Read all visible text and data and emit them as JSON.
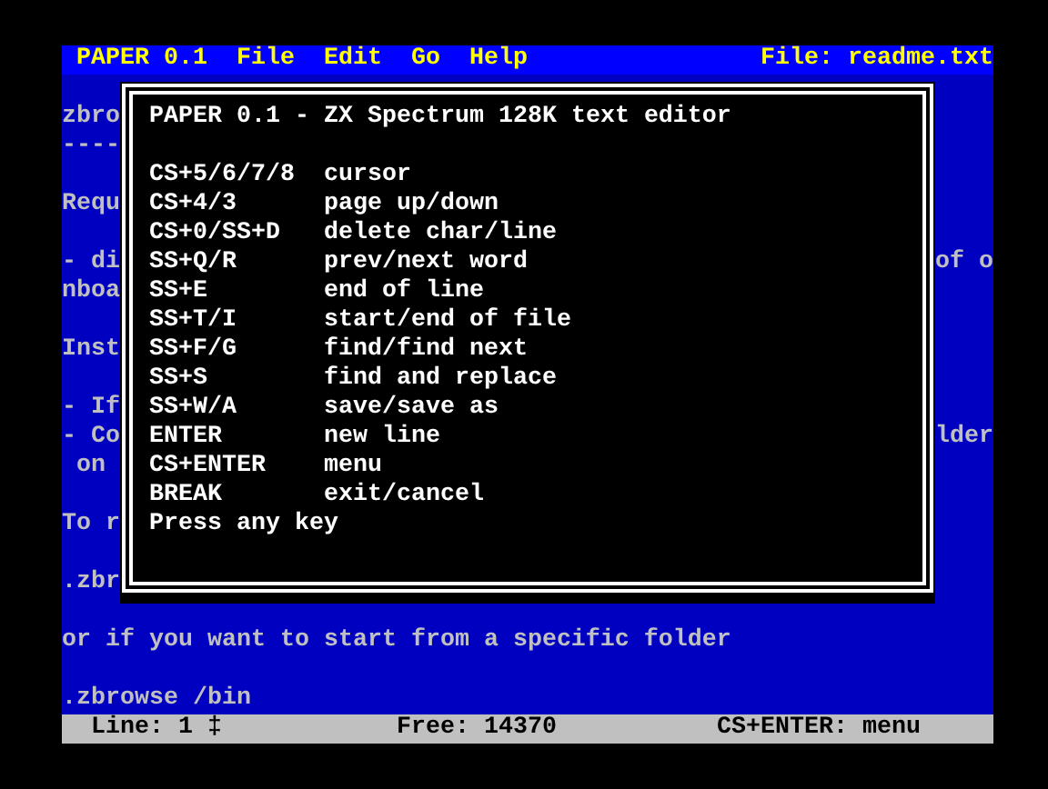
{
  "menu_bar": {
    "title": "PAPER 0.1",
    "items": [
      "File",
      "Edit",
      "Go",
      "Help"
    ],
    "file_label": "File: readme.txt"
  },
  "document_paragraphs": [
    {
      "lines": [
        {
          "left": "zbro"
        },
        {
          "left": "----"
        }
      ]
    },
    {
      "lines": [
        {
          "left": "Requ"
        }
      ]
    },
    {
      "lines": [
        {
          "left": "- di",
          "right": "of o"
        },
        {
          "left": "nboa"
        }
      ]
    },
    {
      "lines": [
        {
          "left": "Inst"
        }
      ]
    },
    {
      "lines": [
        {
          "left": "- If"
        },
        {
          "left": "- Co",
          "right": "lder"
        },
        {
          "left": " on"
        }
      ]
    },
    {
      "lines": [
        {
          "left": "To r"
        }
      ]
    },
    {
      "lines": [
        {
          "left": ".zbr"
        }
      ]
    },
    {
      "lines": [
        {
          "left": "or if you want to start from a specific folder"
        }
      ]
    },
    {
      "lines": [
        {
          "left": ".zbrowse /bin"
        }
      ]
    }
  ],
  "help_dialog": {
    "title": "PAPER 0.1 - ZX Spectrum 128K text editor",
    "shortcuts": [
      {
        "keys": "CS+5/6/7/8",
        "action": "cursor"
      },
      {
        "keys": "CS+4/3",
        "action": "page up/down"
      },
      {
        "keys": "CS+0/SS+D",
        "action": "delete char/line"
      },
      {
        "keys": "SS+Q/R",
        "action": "prev/next word"
      },
      {
        "keys": "SS+E",
        "action": "end of line"
      },
      {
        "keys": "SS+T/I",
        "action": "start/end of file"
      },
      {
        "keys": "SS+F/G",
        "action": "find/find next"
      },
      {
        "keys": "SS+S",
        "action": "find and replace"
      },
      {
        "keys": "SS+W/A",
        "action": "save/save as"
      },
      {
        "keys": "ENTER",
        "action": "new line"
      },
      {
        "keys": "CS+ENTER",
        "action": "menu"
      },
      {
        "keys": "BREAK",
        "action": "exit/cancel"
      }
    ],
    "prompt": "Press any key"
  },
  "status_bar": {
    "line": "Line: 1 ‡",
    "free": "Free: 14370",
    "hint": "CS+ENTER: menu"
  }
}
